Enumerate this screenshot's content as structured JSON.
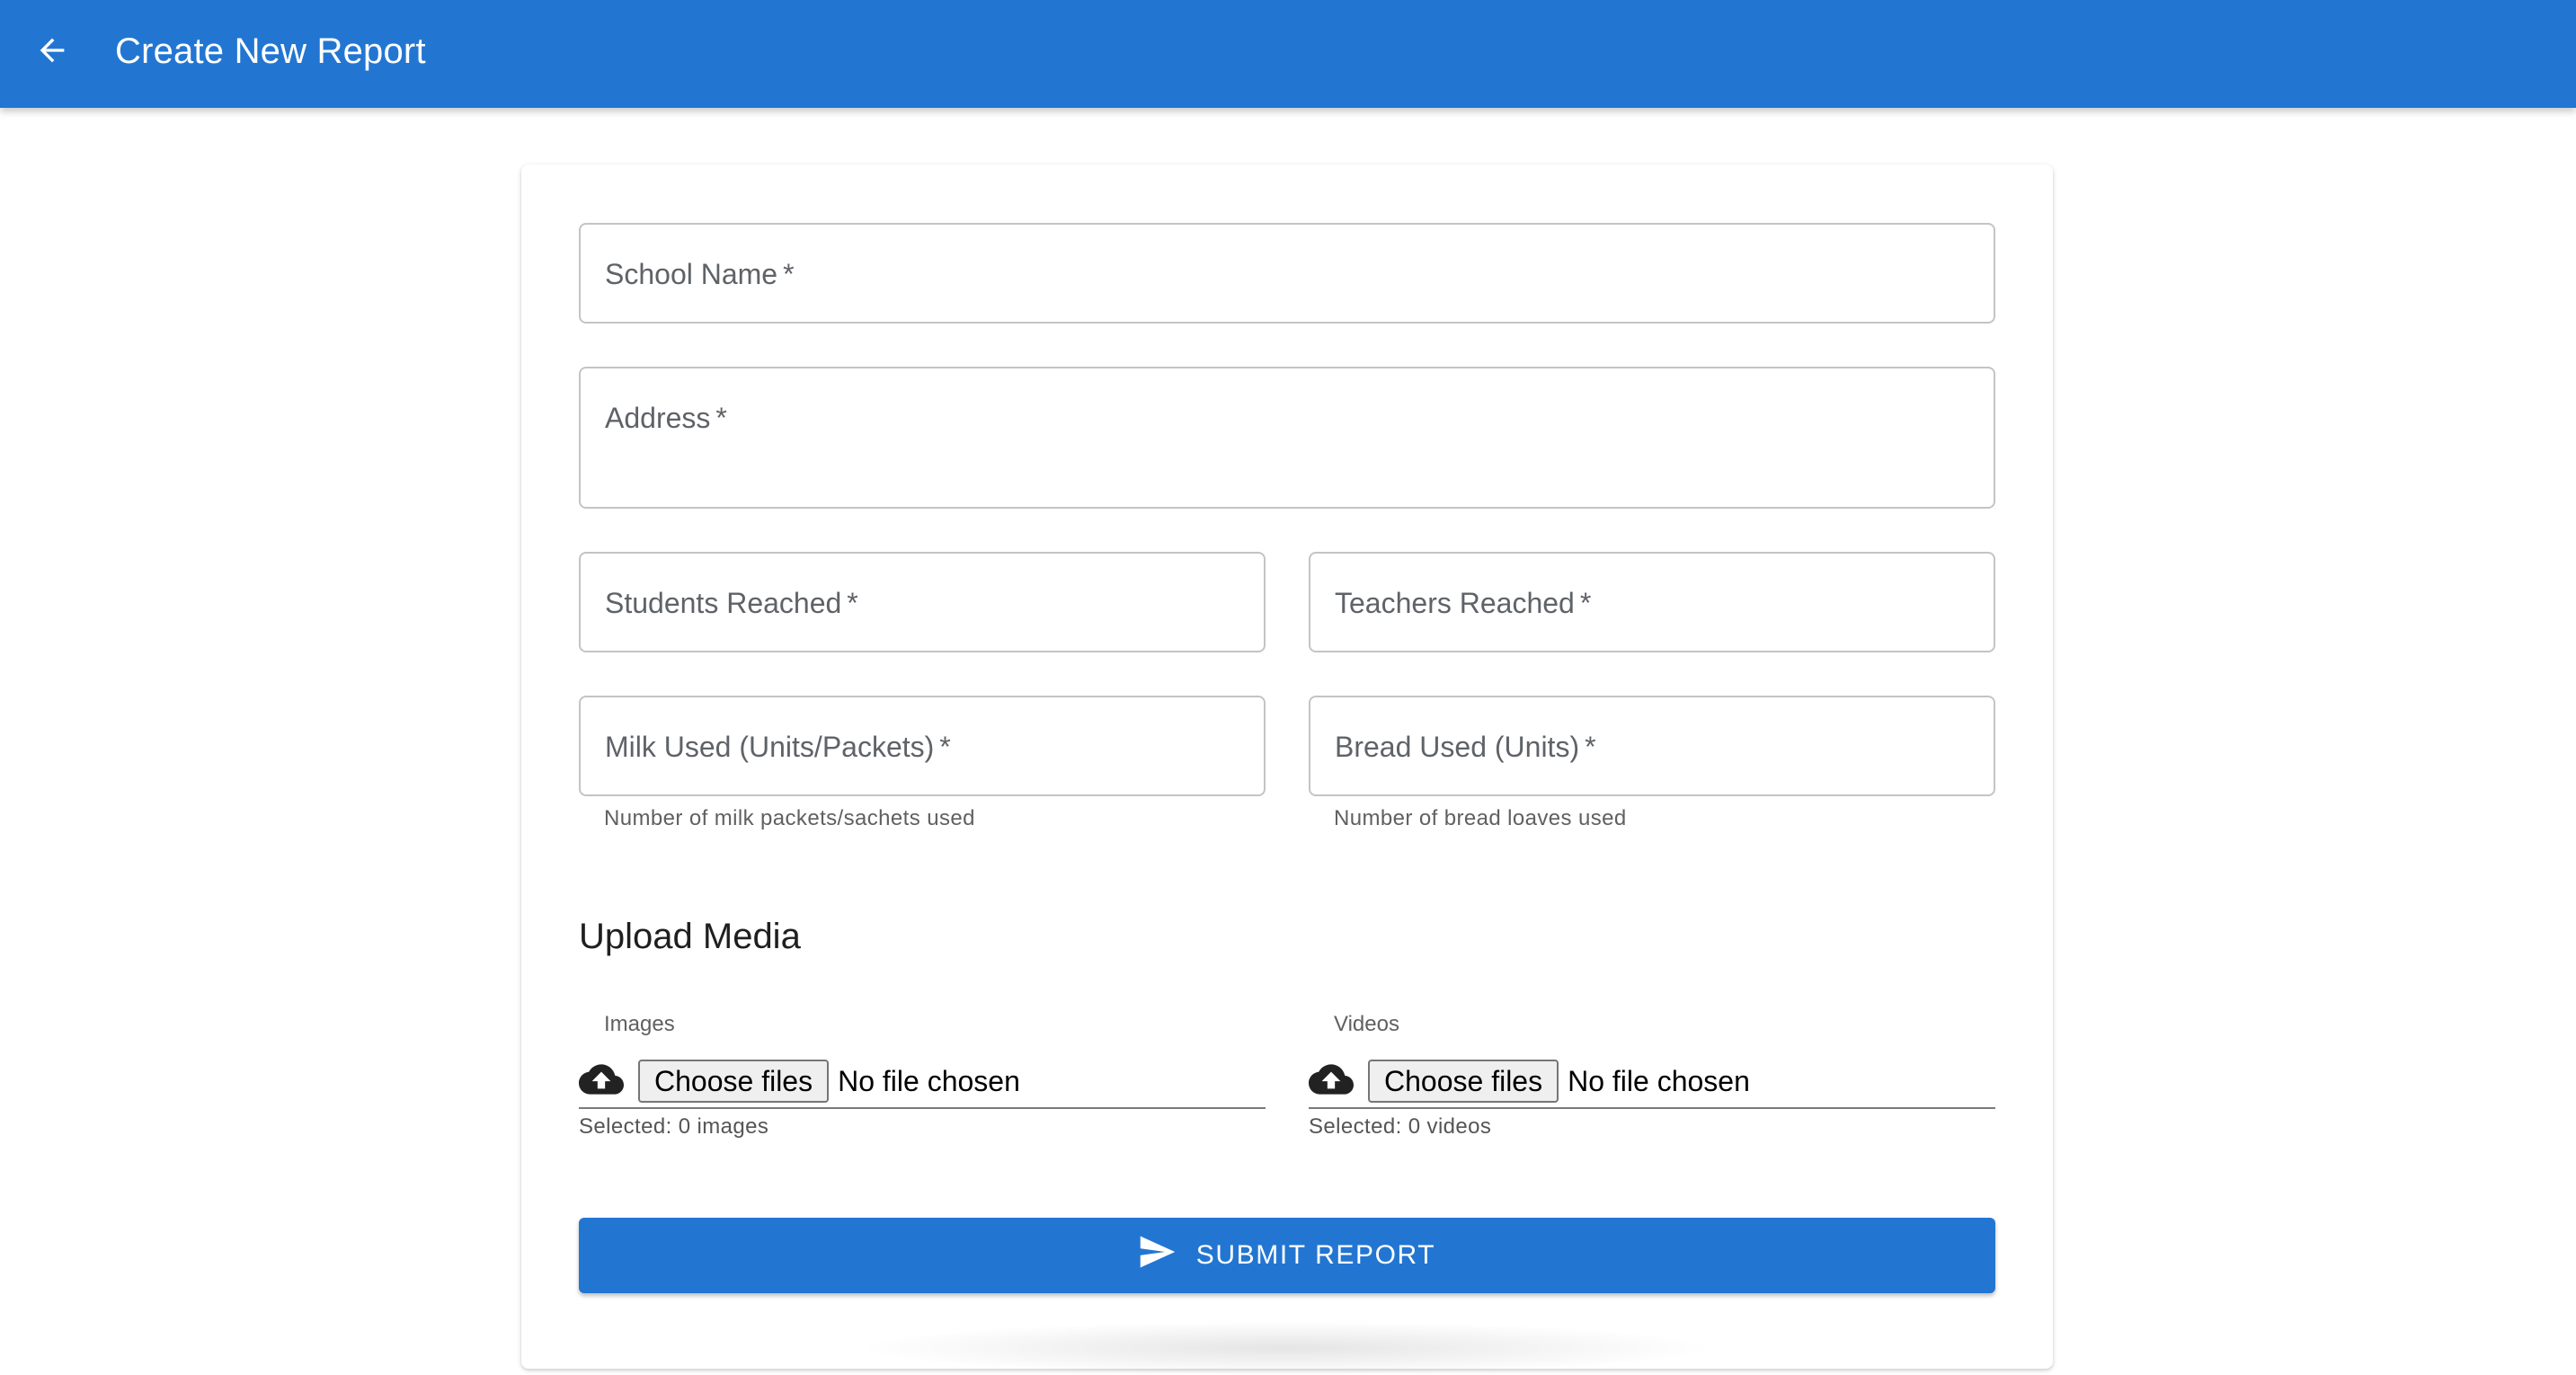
{
  "appbar": {
    "title": "Create New Report",
    "back_icon": "arrow-left-icon",
    "color": "#2276d2"
  },
  "form": {
    "school_name": {
      "label": "School Name",
      "required_mark": "*",
      "value": ""
    },
    "address": {
      "label": "Address",
      "required_mark": "*",
      "value": ""
    },
    "students_reached": {
      "label": "Students Reached",
      "required_mark": "*",
      "value": ""
    },
    "teachers_reached": {
      "label": "Teachers Reached",
      "required_mark": "*",
      "value": ""
    },
    "milk_used": {
      "label": "Milk Used (Units/Packets)",
      "required_mark": "*",
      "helper": "Number of milk packets/sachets used",
      "value": ""
    },
    "bread_used": {
      "label": "Bread Used (Units)",
      "required_mark": "*",
      "helper": "Number of bread loaves used",
      "value": ""
    }
  },
  "media": {
    "section_title": "Upload Media",
    "images": {
      "label": "Images",
      "icon": "cloud-upload-icon",
      "button_label": "Choose files",
      "status": "No file chosen",
      "selected": "Selected: 0 images"
    },
    "videos": {
      "label": "Videos",
      "icon": "cloud-upload-icon",
      "button_label": "Choose files",
      "status": "No file chosen",
      "selected": "Selected: 0 videos"
    }
  },
  "submit": {
    "label": "SUBMIT REPORT",
    "icon": "send-icon",
    "color": "#2276d2"
  }
}
